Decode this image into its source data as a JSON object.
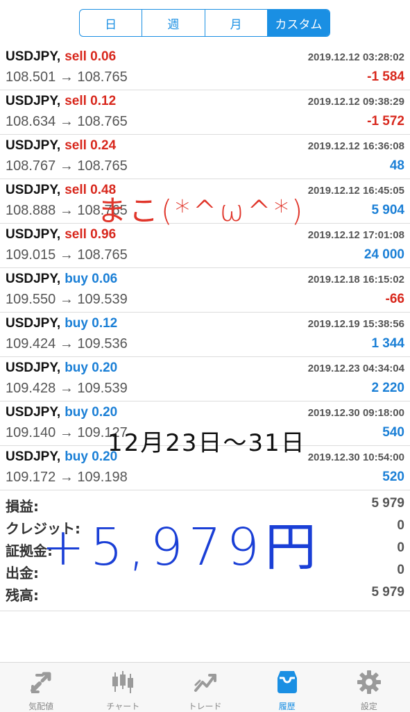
{
  "period_tabs": [
    {
      "label": "日",
      "active": false
    },
    {
      "label": "週",
      "active": false
    },
    {
      "label": "月",
      "active": false
    },
    {
      "label": "カスタム",
      "active": true
    }
  ],
  "trades": [
    {
      "symbol": "USDJPY,",
      "type": "sell 0.06",
      "side": "sell",
      "prices": "108.501 → 108.765",
      "time": "2019.12.12 03:28:02",
      "profit": "-1 584",
      "sign": "neg"
    },
    {
      "symbol": "USDJPY,",
      "type": "sell 0.12",
      "side": "sell",
      "prices": "108.634 → 108.765",
      "time": "2019.12.12 09:38:29",
      "profit": "-1 572",
      "sign": "neg"
    },
    {
      "symbol": "USDJPY,",
      "type": "sell 0.24",
      "side": "sell",
      "prices": "108.767 → 108.765",
      "time": "2019.12.12 16:36:08",
      "profit": "48",
      "sign": "pos"
    },
    {
      "symbol": "USDJPY,",
      "type": "sell 0.48",
      "side": "sell",
      "prices": "108.888 → 108.765",
      "time": "2019.12.12 16:45:05",
      "profit": "5 904",
      "sign": "pos"
    },
    {
      "symbol": "USDJPY,",
      "type": "sell 0.96",
      "side": "sell",
      "prices": "109.015 → 108.765",
      "time": "2019.12.12 17:01:08",
      "profit": "24 000",
      "sign": "pos"
    },
    {
      "symbol": "USDJPY,",
      "type": "buy 0.06",
      "side": "buy",
      "prices": "109.550 → 109.539",
      "time": "2019.12.18 16:15:02",
      "profit": "-66",
      "sign": "neg"
    },
    {
      "symbol": "USDJPY,",
      "type": "buy 0.12",
      "side": "buy",
      "prices": "109.424 → 109.536",
      "time": "2019.12.19 15:38:56",
      "profit": "1 344",
      "sign": "pos"
    },
    {
      "symbol": "USDJPY,",
      "type": "buy 0.20",
      "side": "buy",
      "prices": "109.428 → 109.539",
      "time": "2019.12.23 04:34:04",
      "profit": "2 220",
      "sign": "pos"
    },
    {
      "symbol": "USDJPY,",
      "type": "buy 0.20",
      "side": "buy",
      "prices": "109.140 → 109.127",
      "time": "2019.12.30 09:18:00",
      "profit": "540",
      "sign": "pos"
    },
    {
      "symbol": "USDJPY,",
      "type": "buy 0.20",
      "side": "buy",
      "prices": "109.172 → 109.198",
      "time": "2019.12.30 10:54:00",
      "profit": "520",
      "sign": "pos"
    }
  ],
  "summary": [
    {
      "label": "損益:",
      "value": "5 979"
    },
    {
      "label": "クレジット:",
      "value": "0"
    },
    {
      "label": "証拠金:",
      "value": "0"
    },
    {
      "label": "出金:",
      "value": "0"
    },
    {
      "label": "残高:",
      "value": "5 979"
    }
  ],
  "annotations": {
    "red_note": "まこ(*^ω^*)",
    "date_range": "12月23日〜31日",
    "total": "+5,979円"
  },
  "tabbar": [
    {
      "label": "気配値",
      "icon": "quotes-icon",
      "active": false
    },
    {
      "label": "チャート",
      "icon": "chart-icon",
      "active": false
    },
    {
      "label": "トレード",
      "icon": "trade-icon",
      "active": false
    },
    {
      "label": "履歴",
      "icon": "history-icon",
      "active": true
    },
    {
      "label": "設定",
      "icon": "settings-icon",
      "active": false
    }
  ],
  "colors": {
    "accent": "#1a8fe3",
    "sell": "#d8271c",
    "buy": "#1a7fd6",
    "inactive_icon": "#9a9a9a"
  }
}
